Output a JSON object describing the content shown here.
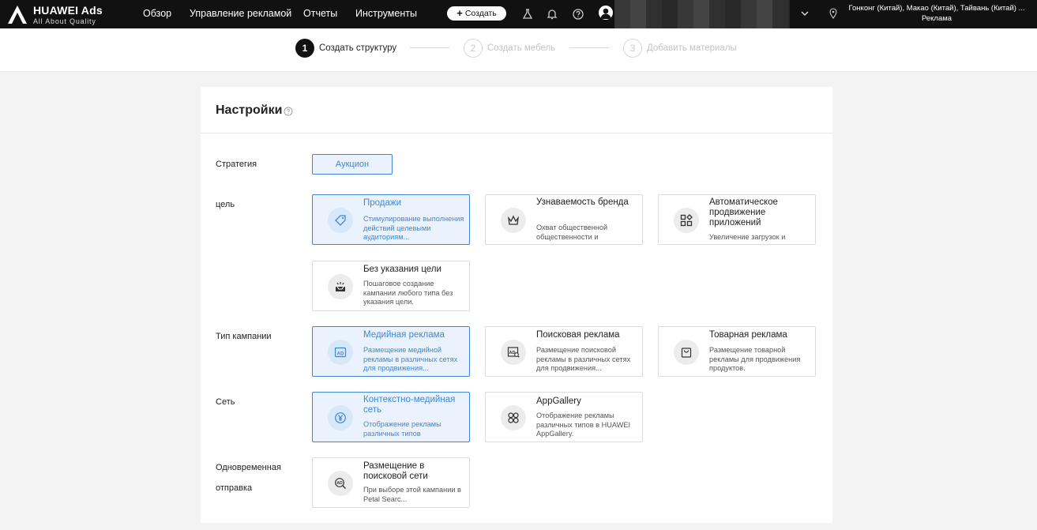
{
  "header": {
    "logo_title": "HUAWEI Ads",
    "logo_sub": "All About Quality",
    "nav": [
      "Обзор",
      "Управление рекламой",
      "Отчеты",
      "Инструменты"
    ],
    "create_label": "Создать",
    "region_line1": "Гонконг (Китай), Макао (Китай), Тайвань (Китай) ...",
    "region_line2": "Реклама"
  },
  "steps": [
    {
      "num": "1",
      "label": "Создать структуру",
      "active": true
    },
    {
      "num": "2",
      "label": "Создать мебель",
      "active": false
    },
    {
      "num": "3",
      "label": "Добавить материалы",
      "active": false
    }
  ],
  "panel": {
    "title": "Настройки",
    "strategy_label": "Стратегия",
    "strategy_value": "Аукцион",
    "goal_label": "цель",
    "campaign_type_label": "Тип кампании",
    "network_label": "Сеть",
    "simultaneous_label_1": "Одновременная",
    "simultaneous_label_2": "отправка"
  },
  "goals": [
    {
      "title": "Продажи",
      "desc": "Стимулирование выполнения действий целевыми аудиториям...",
      "icon": "tag-icon",
      "selected": true
    },
    {
      "title": "Узнаваемость бренда",
      "desc": "Охват общественной общественности и",
      "icon": "crown-icon",
      "selected": false
    },
    {
      "title": "Автоматическое продвижение приложений",
      "desc": "Увеличение загрузок и",
      "icon": "apps-icon",
      "selected": false
    },
    {
      "title": "Без указания цели",
      "desc": "Пошаговое создание кампании любого типа без указания цели.",
      "icon": "inbox-icon",
      "selected": false
    }
  ],
  "campaign_types": [
    {
      "title": "Медийная реклама",
      "desc": "Размещение медийной рекламы в различных сетях для продвижения...",
      "icon": "ad-display-icon",
      "selected": true
    },
    {
      "title": "Поисковая реклама",
      "desc": "Размещение поисковой рекламы в различных сетях для продвижения...",
      "icon": "ad-search-icon",
      "selected": false
    },
    {
      "title": "Товарная реклама",
      "desc": "Размещение товарной рекламы для продвижения продуктов.",
      "icon": "shopping-bag-icon",
      "selected": false
    }
  ],
  "networks": [
    {
      "title": "Контекстно-медийная сеть",
      "desc": "Отображение рекламы различных типов",
      "icon": "yen-coin-icon",
      "selected": true
    },
    {
      "title": "AppGallery",
      "desc": "Отображение рекламы различных типов в HUAWEI AppGallery.",
      "icon": "appgallery-icon",
      "selected": false
    }
  ],
  "simultaneous": [
    {
      "title": "Размещение в поисковой сети",
      "desc": "При выборе этой кампании в Petal Searc...",
      "icon": "ad-magnifier-icon",
      "selected": false
    }
  ]
}
